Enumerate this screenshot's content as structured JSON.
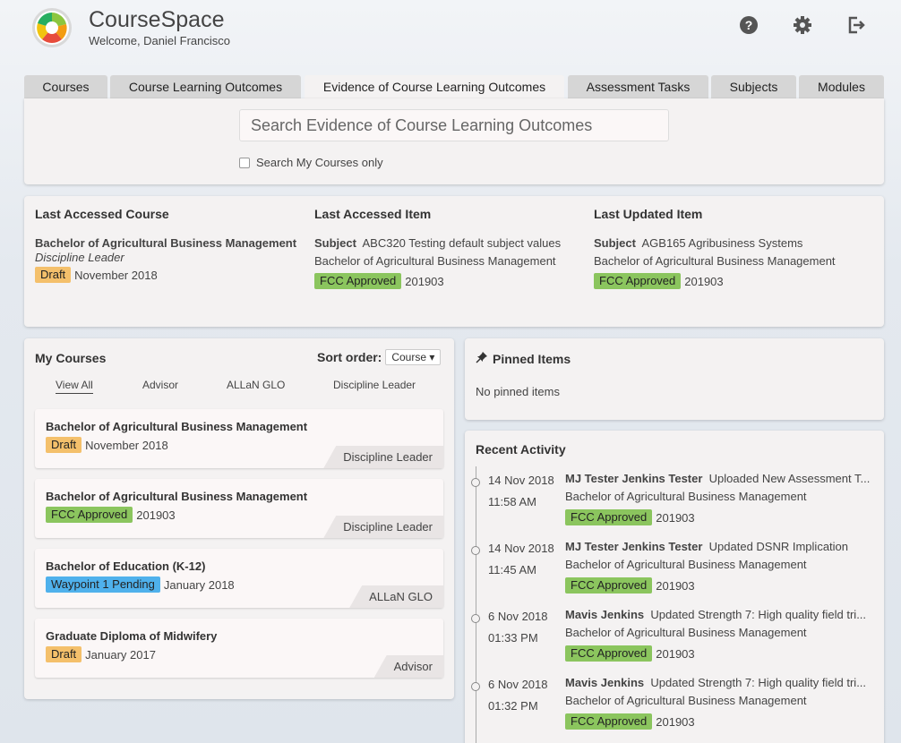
{
  "app": {
    "title": "CourseSpace",
    "welcome": "Welcome, Daniel Francisco"
  },
  "header_icons": [
    "help-icon",
    "gear-icon",
    "logout-icon"
  ],
  "tabs": [
    {
      "label": "Courses"
    },
    {
      "label": "Course Learning Outcomes"
    },
    {
      "label": "Evidence of Course Learning Outcomes",
      "active": true
    },
    {
      "label": "Assessment Tasks"
    },
    {
      "label": "Subjects"
    },
    {
      "label": "Modules"
    }
  ],
  "search": {
    "placeholder": "Search Evidence of Course Learning Outcomes",
    "value": "",
    "my_courses_label": "Search My Courses only",
    "my_courses_checked": false
  },
  "last_accessed_course": {
    "heading": "Last Accessed Course",
    "name": "Bachelor of Agricultural Business Management",
    "role": "Discipline Leader",
    "status": "Draft",
    "date": "November 2018"
  },
  "last_accessed_item": {
    "heading": "Last Accessed Item",
    "type": "Subject",
    "name": "ABC320 Testing default subject values",
    "course": "Bachelor of Agricultural Business Management",
    "status": "FCC Approved",
    "period": "201903"
  },
  "last_updated_item": {
    "heading": "Last Updated Item",
    "type": "Subject",
    "name": "AGB165 Agribusiness Systems",
    "course": "Bachelor of Agricultural Business Management",
    "status": "FCC Approved",
    "period": "201903"
  },
  "my_courses": {
    "heading": "My Courses",
    "sort_label": "Sort order:",
    "sort_value": "Course",
    "filters": [
      "View All",
      "Advisor",
      "ALLaN GLO",
      "Discipline Leader"
    ],
    "active_filter": "View All",
    "items": [
      {
        "name": "Bachelor of Agricultural Business Management",
        "status": "Draft",
        "date": "November 2018",
        "role": "Discipline Leader"
      },
      {
        "name": "Bachelor of Agricultural Business Management",
        "status": "FCC Approved",
        "date": "201903",
        "role": "Discipline Leader"
      },
      {
        "name": "Bachelor of Education (K-12)",
        "status": "Waypoint 1 Pending",
        "date": "January 2018",
        "role": "ALLaN GLO"
      },
      {
        "name": "Graduate Diploma of Midwifery",
        "status": "Draft",
        "date": "January 2017",
        "role": "Advisor"
      }
    ]
  },
  "pinned": {
    "heading": "Pinned Items",
    "empty_text": "No pinned items"
  },
  "recent_activity": {
    "heading": "Recent Activity",
    "items": [
      {
        "date": "14 Nov 2018",
        "time": "11:58 AM",
        "user": "MJ Tester Jenkins Tester",
        "action": "Uploaded New Assessment T...",
        "course": "Bachelor of Agricultural Business Management",
        "status": "FCC Approved",
        "period": "201903"
      },
      {
        "date": "14 Nov 2018",
        "time": "11:45 AM",
        "user": "MJ Tester Jenkins Tester",
        "action": "Updated DSNR Implication",
        "course": "Bachelor of Agricultural Business Management",
        "status": "FCC Approved",
        "period": "201903"
      },
      {
        "date": "6 Nov 2018",
        "time": "01:33 PM",
        "user": "Mavis Jenkins",
        "action": "Updated Strength 7: High quality field tri...",
        "course": "Bachelor of Agricultural Business Management",
        "status": "FCC Approved",
        "period": "201903"
      },
      {
        "date": "6 Nov 2018",
        "time": "01:32 PM",
        "user": "Mavis Jenkins",
        "action": "Updated Strength 7: High quality field tri...",
        "course": "Bachelor of Agricultural Business Management",
        "status": "FCC Approved",
        "period": "201903"
      }
    ]
  },
  "colors": {
    "draft": "#f4c06b",
    "fcc_approved": "#8bc55e",
    "waypoint_pending": "#4fb1ec",
    "panel": "#f4f2f2"
  }
}
